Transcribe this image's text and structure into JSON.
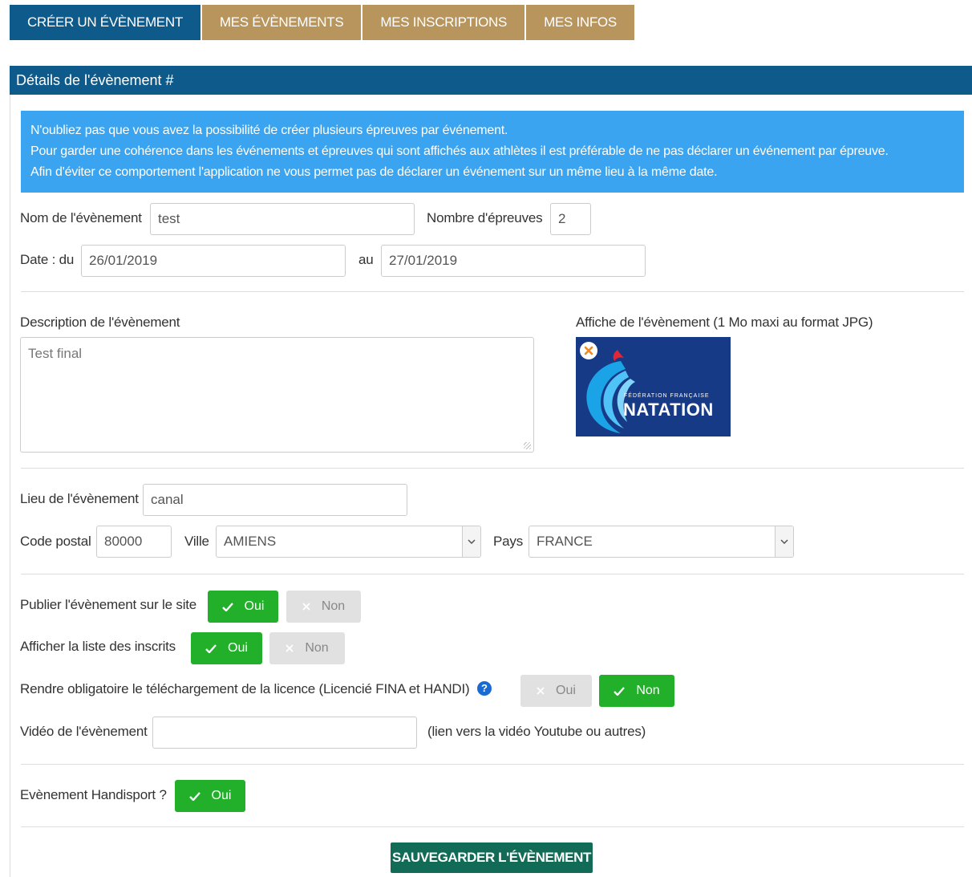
{
  "tabs": [
    {
      "label": "CRÉER UN ÉVÈNEMENT",
      "active": true
    },
    {
      "label": "MES ÉVÈNEMENTS",
      "active": false
    },
    {
      "label": "MES INSCRIPTIONS",
      "active": false
    },
    {
      "label": "MES INFOS",
      "active": false
    }
  ],
  "panel": {
    "title": "Détails de l'évènement #"
  },
  "alert": {
    "lines": [
      "N'oubliez pas que vous avez la possibilité de créer plusieurs épreuves par événement.",
      "Pour garder une cohérence dans les événements et épreuves qui sont affichés aux athlètes il est préférable de ne pas déclarer un événement par épreuve.",
      "Afin d'éviter ce comportement l'application ne vous permet pas de déclarer un événement sur un même lieu à la même date."
    ]
  },
  "form": {
    "event_name": {
      "label": "Nom de l'évènement",
      "value": "test"
    },
    "event_count": {
      "label": "Nombre d'épreuves",
      "value": "2"
    },
    "date": {
      "label_from": "Date : du",
      "from": "26/01/2019",
      "label_to": "au",
      "to": "27/01/2019"
    },
    "description": {
      "label": "Description de l'évènement",
      "value": "Test final"
    },
    "poster": {
      "label": "Affiche de l'évènement (1 Mo maxi au format JPG)",
      "fed_text": "FÉDÉRATION FRANÇAISE",
      "brand": "NATATION"
    },
    "location": {
      "label": "Lieu de l'évènement",
      "value": "canal"
    },
    "postal_code": {
      "label": "Code postal",
      "value": "80000"
    },
    "city": {
      "label": "Ville",
      "value": "AMIENS"
    },
    "country": {
      "label": "Pays",
      "value": "FRANCE"
    },
    "publish": {
      "label": "Publier l'évènement sur le site",
      "yes": "Oui",
      "no": "Non"
    },
    "show_list": {
      "label": "Afficher la liste des inscrits",
      "yes": "Oui",
      "no": "Non"
    },
    "license": {
      "label": "Rendre obligatoire le téléchargement de la licence (Licencié FINA et HANDI)",
      "yes": "Oui",
      "no": "Non"
    },
    "video": {
      "label": "Vidéo de l'évènement",
      "value": "",
      "hint": "(lien vers la vidéo Youtube ou autres)"
    },
    "handisport": {
      "label": "Evènement Handisport ?",
      "yes": "Oui"
    }
  },
  "save_label": "SAUVEGARDER L'ÉVÈNEMENT",
  "colors": {
    "primary": "#0e5a8a",
    "tab_inactive": "#b8955c",
    "alert": "#3aa4f0",
    "toggle_on": "#22b02a",
    "toggle_off": "#e1e1e1",
    "save": "#116b56"
  }
}
